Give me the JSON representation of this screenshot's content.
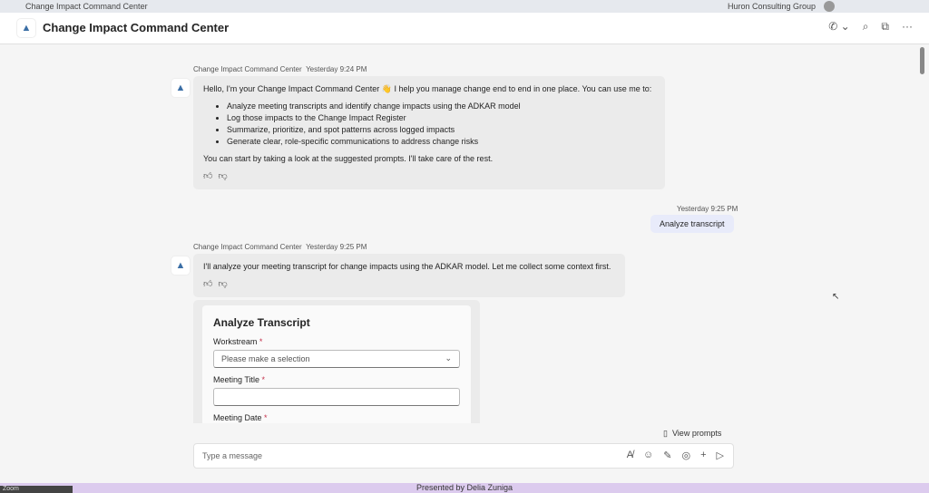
{
  "window": {
    "title": "Change Impact Command Center",
    "org": "Huron Consulting Group"
  },
  "header": {
    "title": "Change Impact Command Center"
  },
  "messages": [
    {
      "sender": "Change Impact Command Center",
      "time": "Yesterday 9:24 PM",
      "intro": "Hello, I'm your Change Impact Command Center 👋 I help you manage change end to end in one place. You can use me to:",
      "bullets": [
        "Analyze meeting transcripts and identify change impacts using the ADKAR model",
        "Log those impacts to the Change Impact Register",
        "Summarize, prioritize, and spot patterns across logged impacts",
        "Generate clear, role-specific communications to address change risks"
      ],
      "outro": "You can start by taking a look at the suggested prompts. I'll take care of the rest."
    },
    {
      "time": "Yesterday 9:25 PM",
      "text": "Analyze transcript"
    },
    {
      "sender": "Change Impact Command Center",
      "time": "Yesterday 9:25 PM",
      "text": "I'll analyze your meeting transcript for change impacts using the ADKAR model. Let me collect some context first."
    }
  ],
  "card": {
    "title": "Analyze Transcript",
    "workstream_label": "Workstream",
    "workstream_placeholder": "Please make a selection",
    "meeting_title_label": "Meeting Title",
    "meeting_date_label": "Meeting Date",
    "required": "*"
  },
  "compose": {
    "view_prompts": "View prompts",
    "placeholder": "Type a message"
  },
  "footer": {
    "text": "Presented by Delia Zuniga",
    "zoom": "Zoom"
  }
}
